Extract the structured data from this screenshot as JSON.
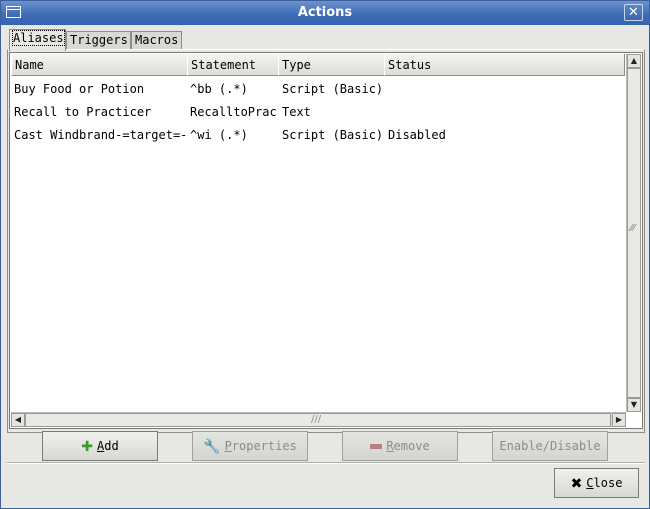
{
  "window": {
    "title": "Actions",
    "close_glyph": "✕"
  },
  "tabs": [
    {
      "label": "Aliases",
      "active": true
    },
    {
      "label": "Triggers",
      "active": false
    },
    {
      "label": "Macros",
      "active": false
    }
  ],
  "table": {
    "columns": [
      "Name",
      "Statement",
      "Type",
      "Status"
    ],
    "rows": [
      [
        "Buy Food or Potion",
        "^bb (.*)",
        "Script (Basic)",
        ""
      ],
      [
        "Recall to Practicer",
        "RecalltoPrac",
        "Text",
        ""
      ],
      [
        "Cast Windbrand-=target=-",
        "^wi (.*)",
        "Script (Basic)",
        "Disabled"
      ]
    ]
  },
  "buttons": {
    "add": {
      "prefix": "",
      "underlined": "A",
      "rest": "dd",
      "icon": "plus-icon"
    },
    "properties": {
      "underlined": "P",
      "rest": "roperties",
      "icon": "wrench-icon"
    },
    "remove": {
      "underlined": "R",
      "rest": "emove",
      "icon": "remove-icon"
    },
    "enable_disable": {
      "label": "Enable/Disable"
    },
    "close": {
      "underlined": "C",
      "rest": "lose",
      "icon": "close-x-icon"
    }
  },
  "colors": {
    "title_bar": "#3f6cb6",
    "add_icon": "#3c9a2a",
    "remove_icon": "#b04040"
  }
}
